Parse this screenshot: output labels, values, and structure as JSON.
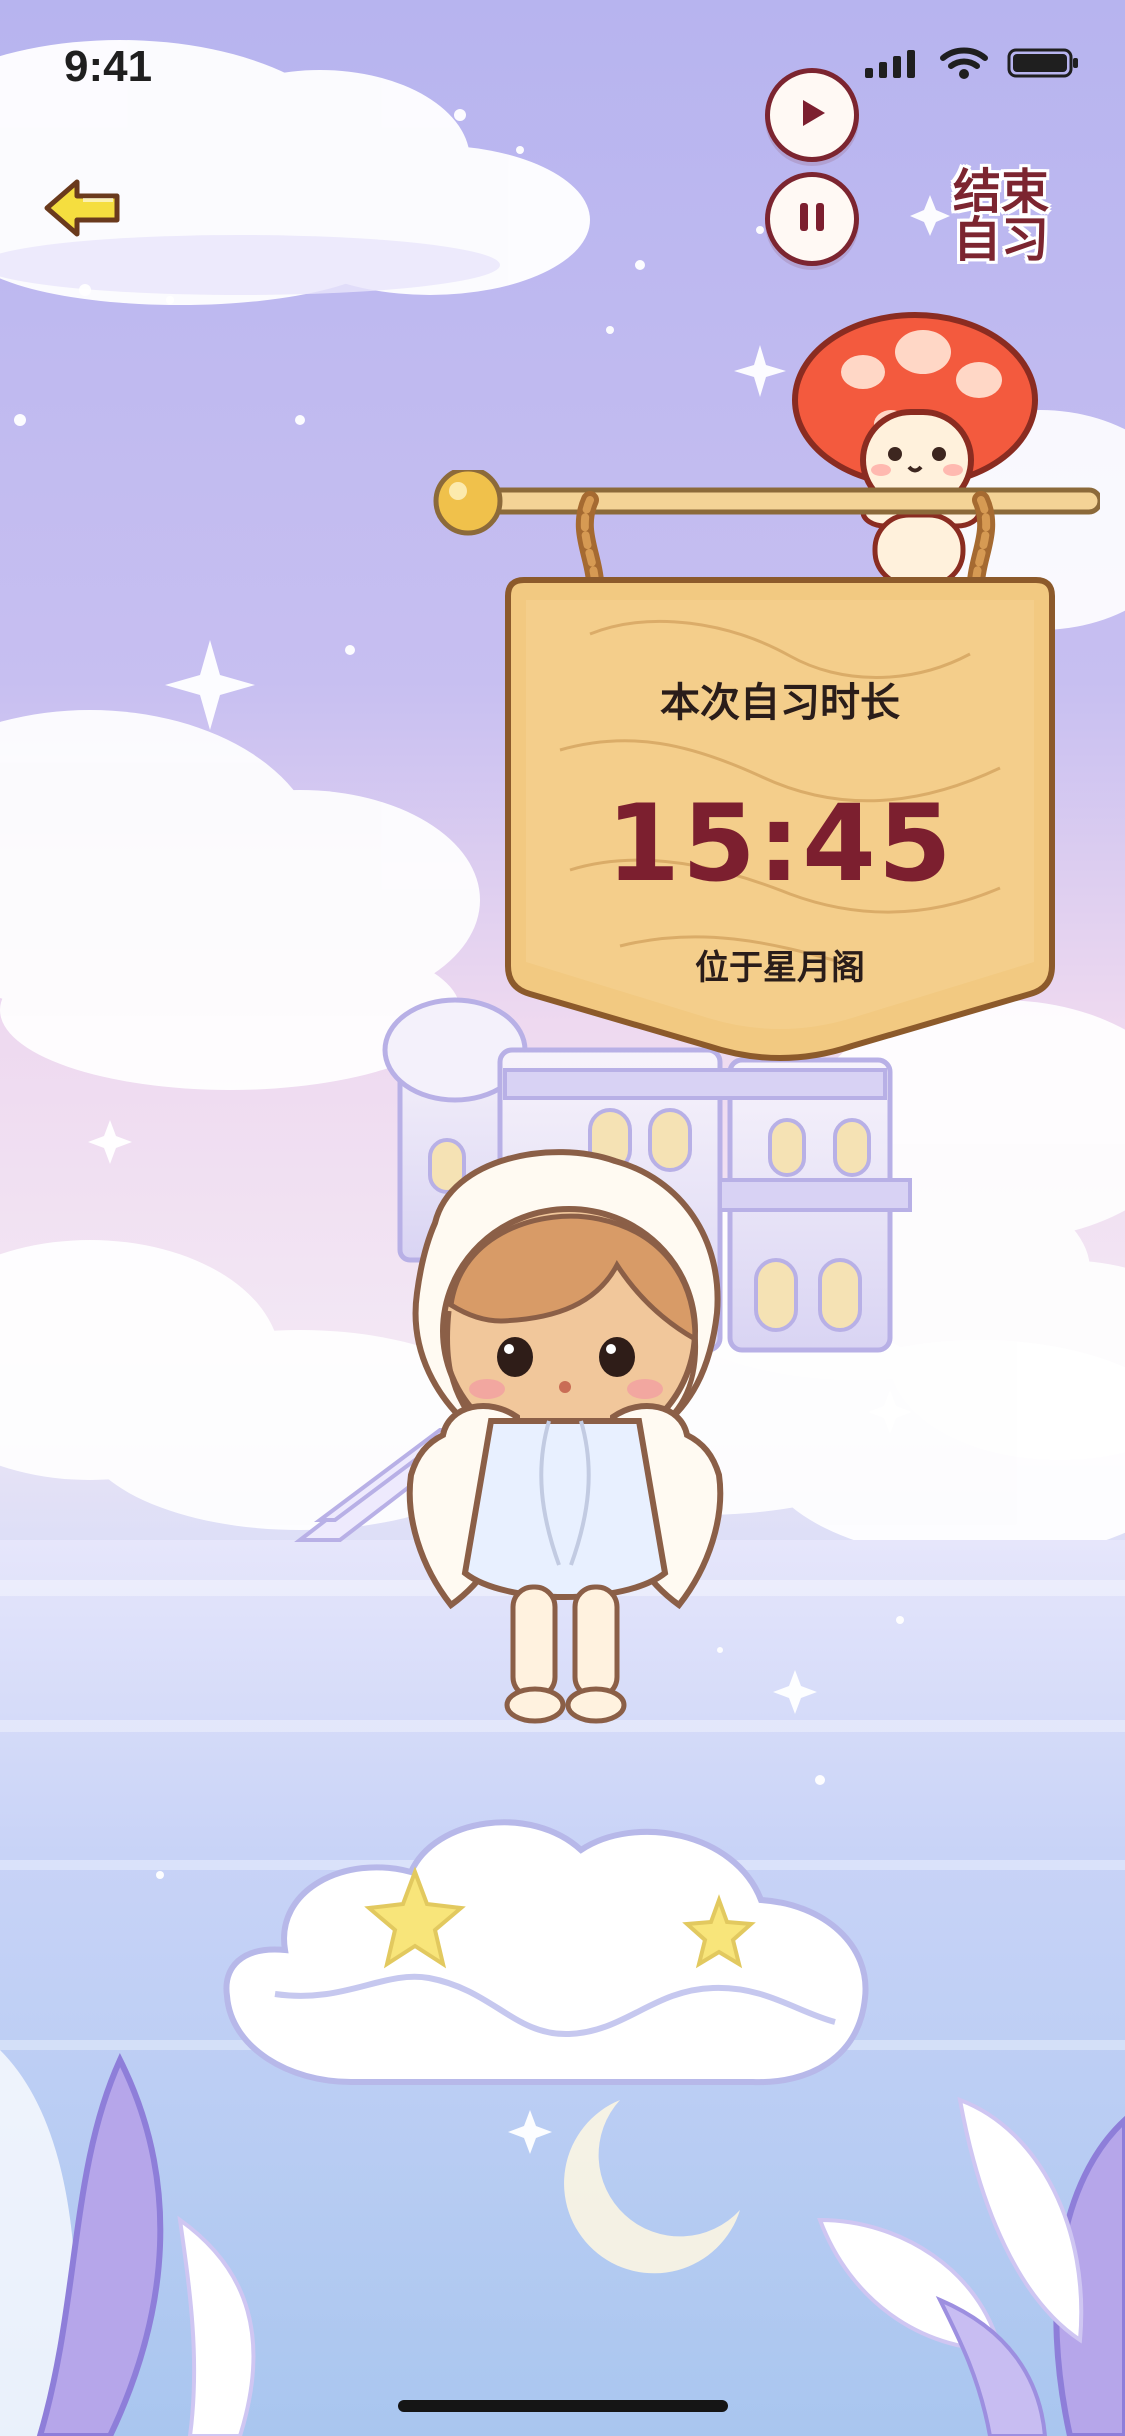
{
  "status_bar": {
    "time": "9:41"
  },
  "controls": {
    "back_icon": "back-arrow-icon",
    "play_icon": "play-icon",
    "pause_icon": "pause-icon",
    "end_label_line1": "结束",
    "end_label_line2": "自习"
  },
  "sign": {
    "title": "本次自习时长",
    "timer": "15:45",
    "location": "位于星月阁"
  },
  "colors": {
    "accent": "#7c1f2f",
    "sign_wood": "#f0c77d",
    "sky_top": "#b7b4ef",
    "water": "#b6c7ee"
  }
}
